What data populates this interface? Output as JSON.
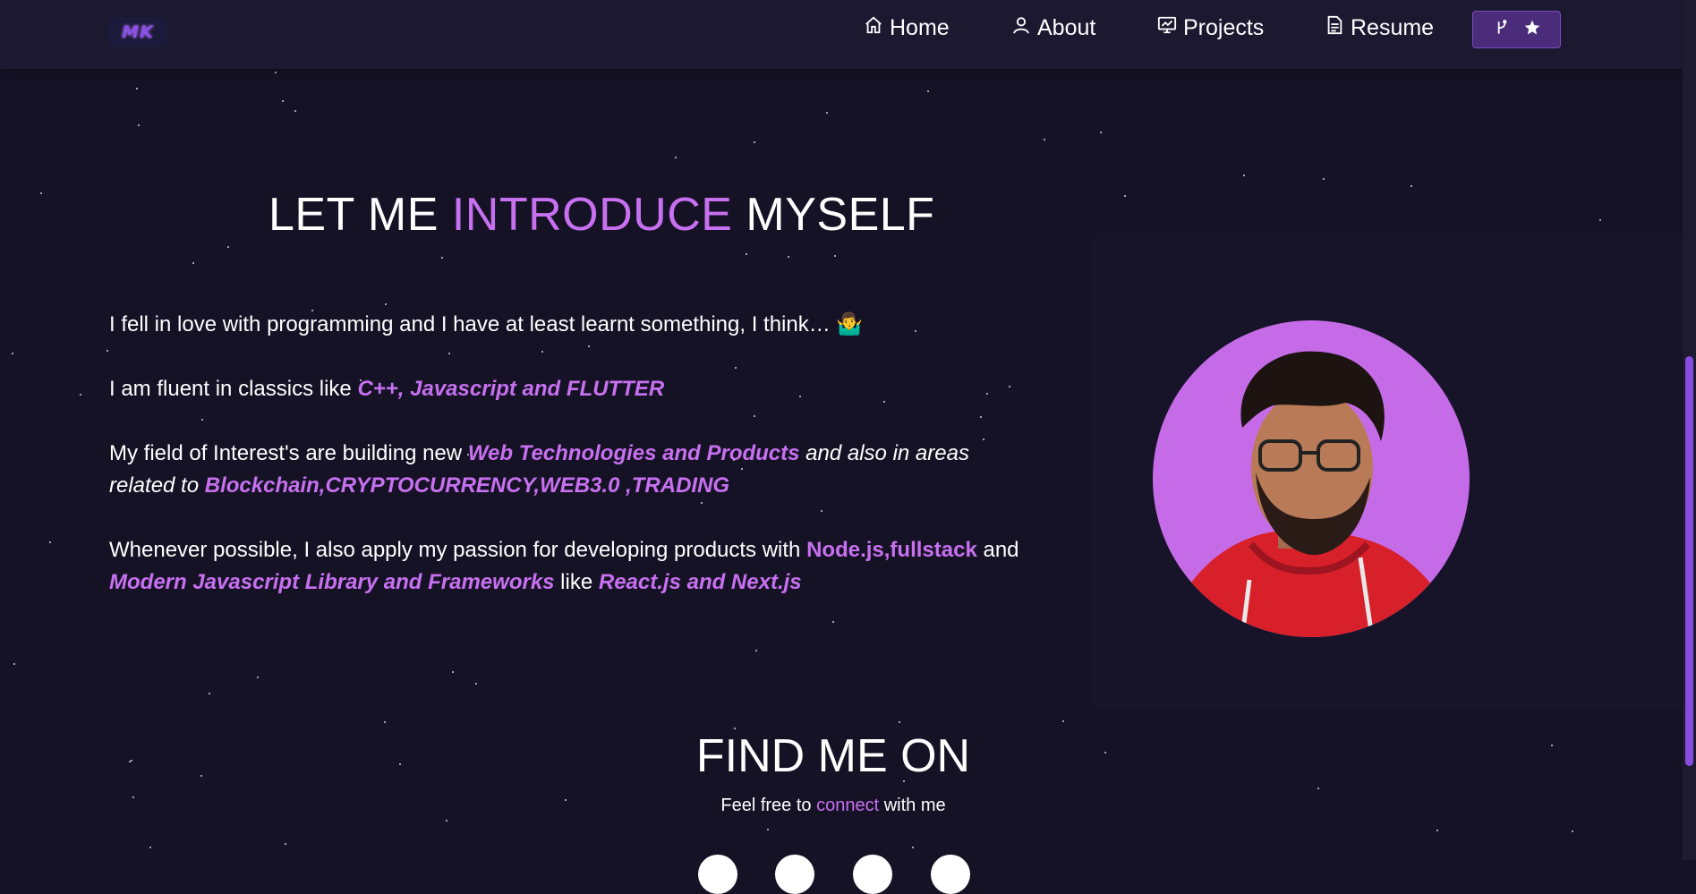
{
  "navbar": {
    "logo_text": "MK",
    "items": [
      {
        "label": "Home",
        "icon": "home-icon"
      },
      {
        "label": "About",
        "icon": "user-icon"
      },
      {
        "label": "Projects",
        "icon": "projects-icon"
      },
      {
        "label": "Resume",
        "icon": "document-icon"
      }
    ],
    "fork_button_icons": [
      "git-fork-icon",
      "star-icon"
    ]
  },
  "about": {
    "title_part1": "LET ME ",
    "title_accent": "INTRODUCE",
    "title_part2": " MYSELF",
    "p1_text": "I fell in love with programming and I have at least learnt something, I think… ",
    "p1_emoji": "🤷‍♂️",
    "p2_text": "I am fluent in classics like ",
    "p2_highlight": "C++, Javascript and FLUTTER",
    "p3_text": "My field of Interest's are building new ",
    "p3_highlight1": "Web Technologies and Products",
    "p3_italic": " and also in areas related to ",
    "p3_highlight2": "Blockchain,CRYPTOCURRENCY,WEB3.0 ,TRADING",
    "p4_text": "Whenever possible, I also apply my passion for developing products with ",
    "p4_highlight1": "Node.js,fullstack",
    "p4_text2": " and ",
    "p4_highlight2": "Modern Javascript Library and Frameworks",
    "p4_text3": "  like ",
    "p4_highlight3": "React.js and Next.js"
  },
  "find": {
    "title": "FIND ME ON",
    "sub_text1": "Feel free to ",
    "sub_accent": "connect",
    "sub_text2": " with me"
  },
  "colors": {
    "background": "#161226",
    "navbar": "#1b1830",
    "accent": "#c770f0",
    "button": "#4a2c7a"
  }
}
